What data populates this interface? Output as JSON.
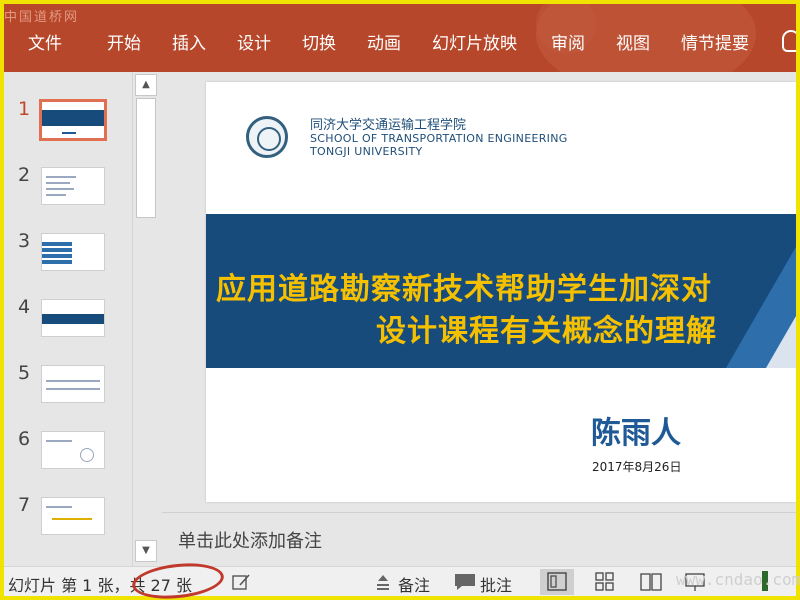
{
  "watermark_top": "中国道桥网",
  "watermark_bottom": "www.cndao.com",
  "ribbon": {
    "tabs": [
      "文件",
      "开始",
      "插入",
      "设计",
      "切换",
      "动画",
      "幻灯片放映",
      "审阅",
      "视图",
      "情节提要"
    ]
  },
  "thumbnails": [
    {
      "num": "1"
    },
    {
      "num": "2"
    },
    {
      "num": "3"
    },
    {
      "num": "4"
    },
    {
      "num": "5"
    },
    {
      "num": "6"
    },
    {
      "num": "7"
    }
  ],
  "slide": {
    "school_cn": "同济大学交通运输工程学院",
    "school_en1": "SCHOOL OF TRANSPORTATION ENGINEERING",
    "school_en2": "TONGJI UNIVERSITY",
    "title_line1": "应用道路勘察新技术帮助学生加深对",
    "title_line2": "设计课程有关概念的理解",
    "author": "陈雨人",
    "date": "2017年8月26日"
  },
  "notes_placeholder": "单击此处添加备注",
  "status": {
    "slide_label": "幻灯片 第 1 张，共 27 张",
    "notes_label": "备注",
    "comments_label": "批注"
  },
  "colors": {
    "ribbon": "#b7472a",
    "band": "#174b7c",
    "title_text": "#f5c000",
    "author_text": "#1f5a96"
  }
}
